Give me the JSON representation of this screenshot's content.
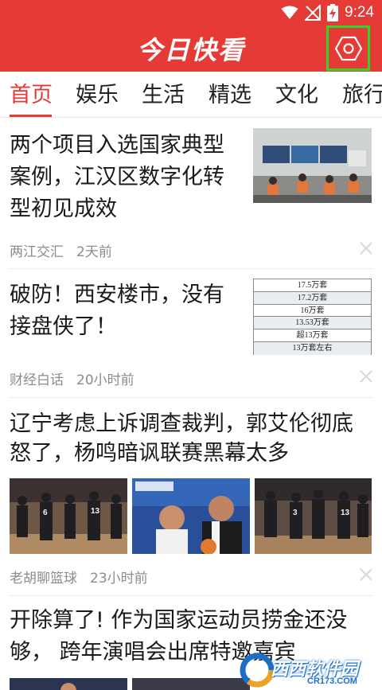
{
  "status_bar": {
    "time": "9:24",
    "icons": [
      "wifi-icon",
      "no-signal-icon",
      "battery-charging-icon"
    ]
  },
  "app_bar": {
    "title": "今日快看",
    "settings_icon": "settings-hexagon-icon"
  },
  "tabs": [
    {
      "label": "首页",
      "active": true
    },
    {
      "label": "娱乐",
      "active": false
    },
    {
      "label": "生活",
      "active": false
    },
    {
      "label": "精选",
      "active": false
    },
    {
      "label": "文化",
      "active": false
    },
    {
      "label": "旅行",
      "active": false
    }
  ],
  "articles": [
    {
      "title_lines": [
        "两个项目入选国家典型",
        "案例，江汉区数字化转",
        "型初见成效"
      ],
      "source": "两江交汇",
      "time": "2天前"
    },
    {
      "title_lines": [
        "破防！西安楼市，没有",
        "接盘侠了！"
      ],
      "source": "财经白话",
      "time": "20小时前",
      "table_rows": [
        "17.5万套",
        "17.2万套",
        "16万套",
        "13.53万套",
        "超13万套",
        "13万套左右"
      ]
    },
    {
      "title_lines": [
        "辽宁考虑上诉调查裁判，郭艾伦彻底",
        "怒了，杨鸣暗讽联赛黑幕太多"
      ],
      "source": "老胡聊篮球",
      "time": "23小时前"
    },
    {
      "title_lines": [
        "开除算了! 作为国家运动员捞金还没",
        "够， 跨年演唱会出席特邀嘉宾"
      ]
    }
  ],
  "watermark": {
    "text": "西西软件园",
    "url": "CR173.COM"
  },
  "colors": {
    "brand_red": "#e63a36",
    "highlight_green": "#2ed62a",
    "meta_gray": "#8c8c8c"
  }
}
